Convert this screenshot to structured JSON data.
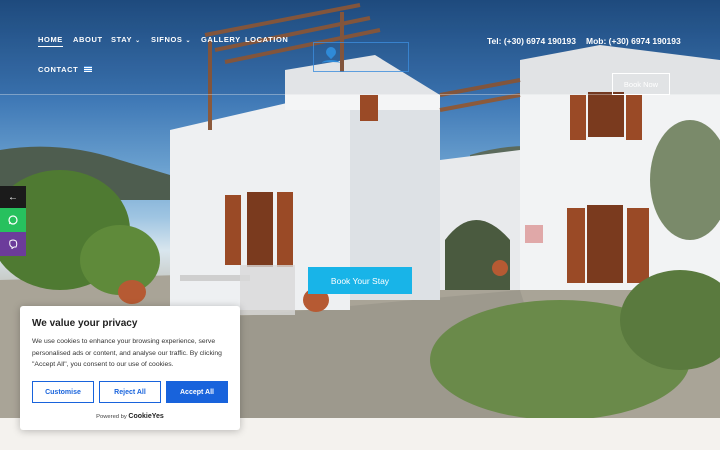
{
  "nav": {
    "items": [
      {
        "label": "HOME",
        "active": true,
        "has_dropdown": false
      },
      {
        "label": "ABOUT",
        "active": false,
        "has_dropdown": false
      },
      {
        "label": "STAY",
        "active": false,
        "has_dropdown": true
      },
      {
        "label": "SIFNOS",
        "active": false,
        "has_dropdown": true
      },
      {
        "label": "GALLERY",
        "active": false,
        "has_dropdown": false
      },
      {
        "label": "LOCATION",
        "active": false,
        "has_dropdown": false
      },
      {
        "label": "CONTACT",
        "active": false,
        "has_dropdown": false
      }
    ],
    "dropdown_glyph": "⌄",
    "language_flag": "greek-flag-icon"
  },
  "contact": {
    "tel": "Tel: (+30) 6974 190193",
    "mob": "Mob: (+30) 6974 190193"
  },
  "hero": {
    "book_now_label": "Book Now",
    "book_stay_label": "Book Your Stay"
  },
  "share": {
    "toggle_glyph": "←",
    "icons": [
      "arrow-left-icon",
      "whatsapp-icon",
      "viber-icon"
    ],
    "colors": {
      "toggle": "#1b1b1b",
      "whatsapp": "#27c15e",
      "viber": "#6c3c9b"
    }
  },
  "cookie": {
    "title": "We value your privacy",
    "body": "We use cookies to enhance your browsing experience, serve personalised ads or content, and analyse our traffic. By clicking \"Accept All\", you consent to our use of cookies.",
    "customise_label": "Customise",
    "reject_label": "Reject All",
    "accept_label": "Accept All",
    "powered_by": "Powered by",
    "brand": "CookieYes",
    "accent": "#1863dc"
  },
  "colors": {
    "book_stay_button": "#18b4e8"
  }
}
